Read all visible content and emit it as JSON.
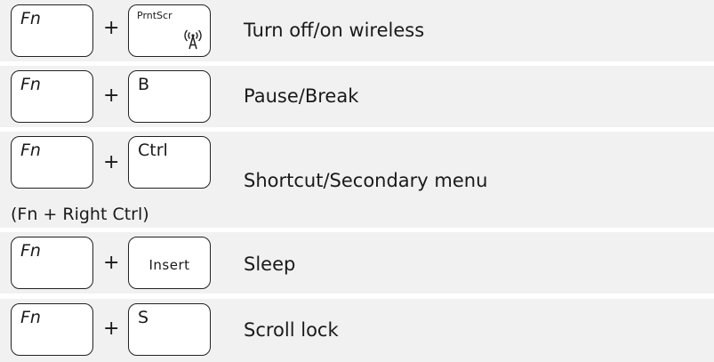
{
  "shortcuts": [
    {
      "modifier": "Fn",
      "plus": "+",
      "key": "PrntScr",
      "action": "Turn off/on wireless"
    },
    {
      "modifier": "Fn",
      "plus": "+",
      "key": "B",
      "action": "Pause/Break"
    },
    {
      "modifier": "Fn",
      "plus": "+",
      "key": "Ctrl",
      "action": "Shortcut/Secondary menu",
      "note": "(Fn + Right Ctrl)"
    },
    {
      "modifier": "Fn",
      "plus": "+",
      "key": "Insert",
      "action": "Sleep"
    },
    {
      "modifier": "Fn",
      "plus": "+",
      "key": "S",
      "action": "Scroll lock"
    }
  ],
  "icons": {
    "wireless": "wireless-antenna-icon"
  },
  "colors": {
    "row_background": "#f1f1f1",
    "key_background": "#ffffff",
    "text": "#1a1a1a"
  }
}
